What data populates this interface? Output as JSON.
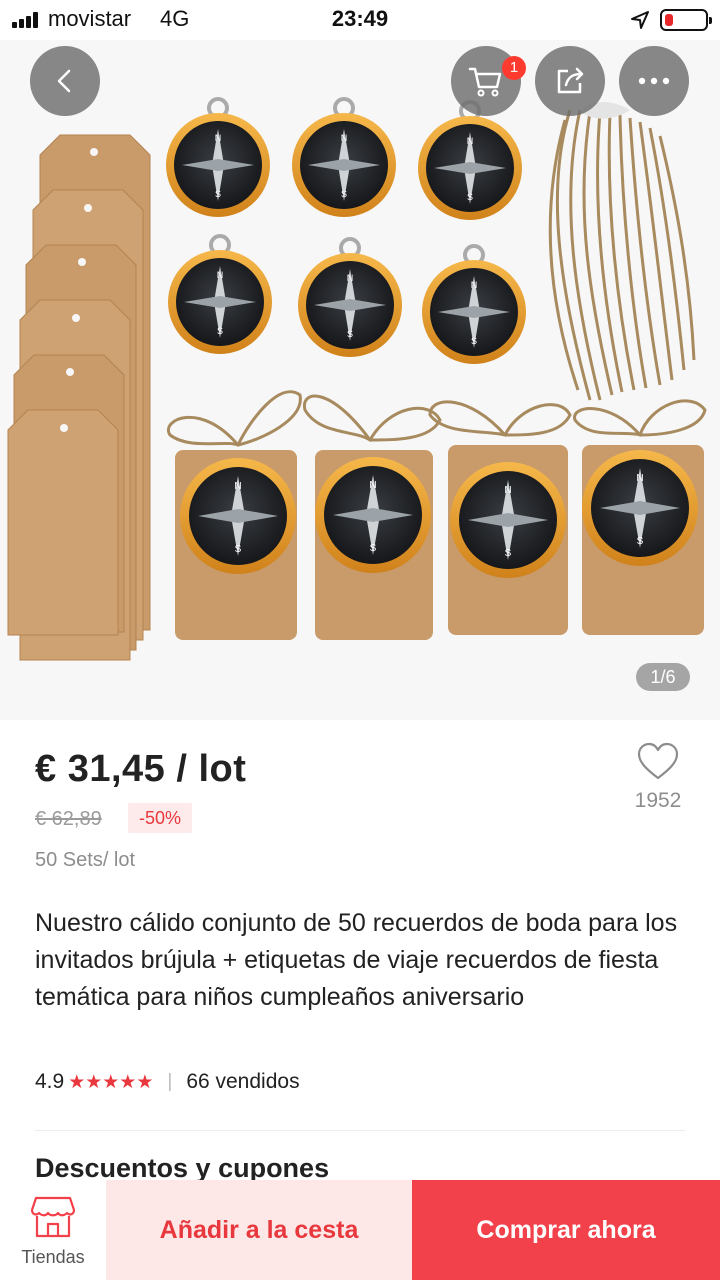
{
  "status_bar": {
    "carrier": "movistar",
    "network": "4G",
    "time": "23:49",
    "battery_level": 0.2,
    "battery_color": "#e8272b",
    "location_icon": "location-arrow-icon"
  },
  "gallery": {
    "current_page": "1/6",
    "cart_count": "1",
    "icons": {
      "back": "chevron-left-icon",
      "cart": "shopping-cart-icon",
      "share": "share-icon",
      "more": "more-icon"
    }
  },
  "product": {
    "price": "€ 31,45 / lot",
    "original_price": "€ 62,89",
    "discount": "-50%",
    "lot_info": "50 Sets/ lot",
    "wishlist_count": "1952",
    "title": "Nuestro cálido conjunto de 50 recuerdos de boda para los invitados brújula + etiquetas de viaje recuerdos de fiesta temática para niños cumpleaños aniversario",
    "rating": "4.9",
    "rating_stars": 5,
    "sold": "66 vendidos"
  },
  "sections": {
    "discounts_title": "Descuentos y cupones"
  },
  "bottom_bar": {
    "store_label": "Tiendas",
    "add_to_cart": "Añadir a la cesta",
    "buy_now": "Comprar ahora"
  },
  "colors": {
    "accent": "#f2414a",
    "accent_light": "#fde7e7",
    "star": "#e8383d"
  }
}
